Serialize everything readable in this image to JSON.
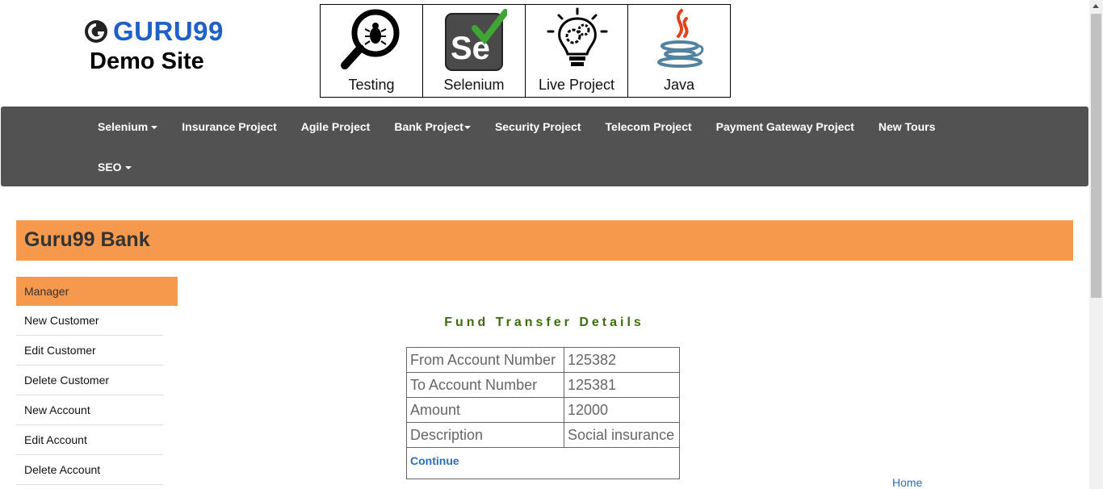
{
  "header": {
    "logo_text": "GURU99",
    "logo_subtitle": "Demo Site"
  },
  "tiles": [
    {
      "label": "Testing",
      "icon": "magnifier-bug-icon"
    },
    {
      "label": "Selenium",
      "icon": "selenium-logo-icon"
    },
    {
      "label": "Live Project",
      "icon": "lightbulb-gears-icon"
    },
    {
      "label": "Java",
      "icon": "java-cup-icon"
    }
  ],
  "nav": {
    "row1": [
      "Selenium",
      "Insurance Project",
      "Agile Project",
      "Bank Project",
      "Security Project",
      "Telecom Project",
      "Payment Gateway Project",
      "New Tours"
    ],
    "row2": [
      "SEO"
    ]
  },
  "banner": {
    "title": "Guru99 Bank"
  },
  "sidebar": {
    "header": "Manager",
    "items": [
      "New Customer",
      "Edit Customer",
      "Delete Customer",
      "New Account",
      "Edit Account",
      "Delete Account"
    ]
  },
  "main": {
    "title": "Fund Transfer Details",
    "rows": [
      {
        "label": "From Account Number",
        "value": "125382"
      },
      {
        "label": "To Account Number",
        "value": "125381"
      },
      {
        "label": "Amount",
        "value": "12000"
      },
      {
        "label": "Description",
        "value": "Social insurance"
      }
    ],
    "continue_label": "Continue",
    "home_label": "Home"
  },
  "colors": {
    "brand_blue": "#1f5fc9",
    "nav_bg": "#525252",
    "banner_orange": "#f6994d",
    "title_green": "#3d6b10",
    "link_blue": "#2a6ebb"
  }
}
